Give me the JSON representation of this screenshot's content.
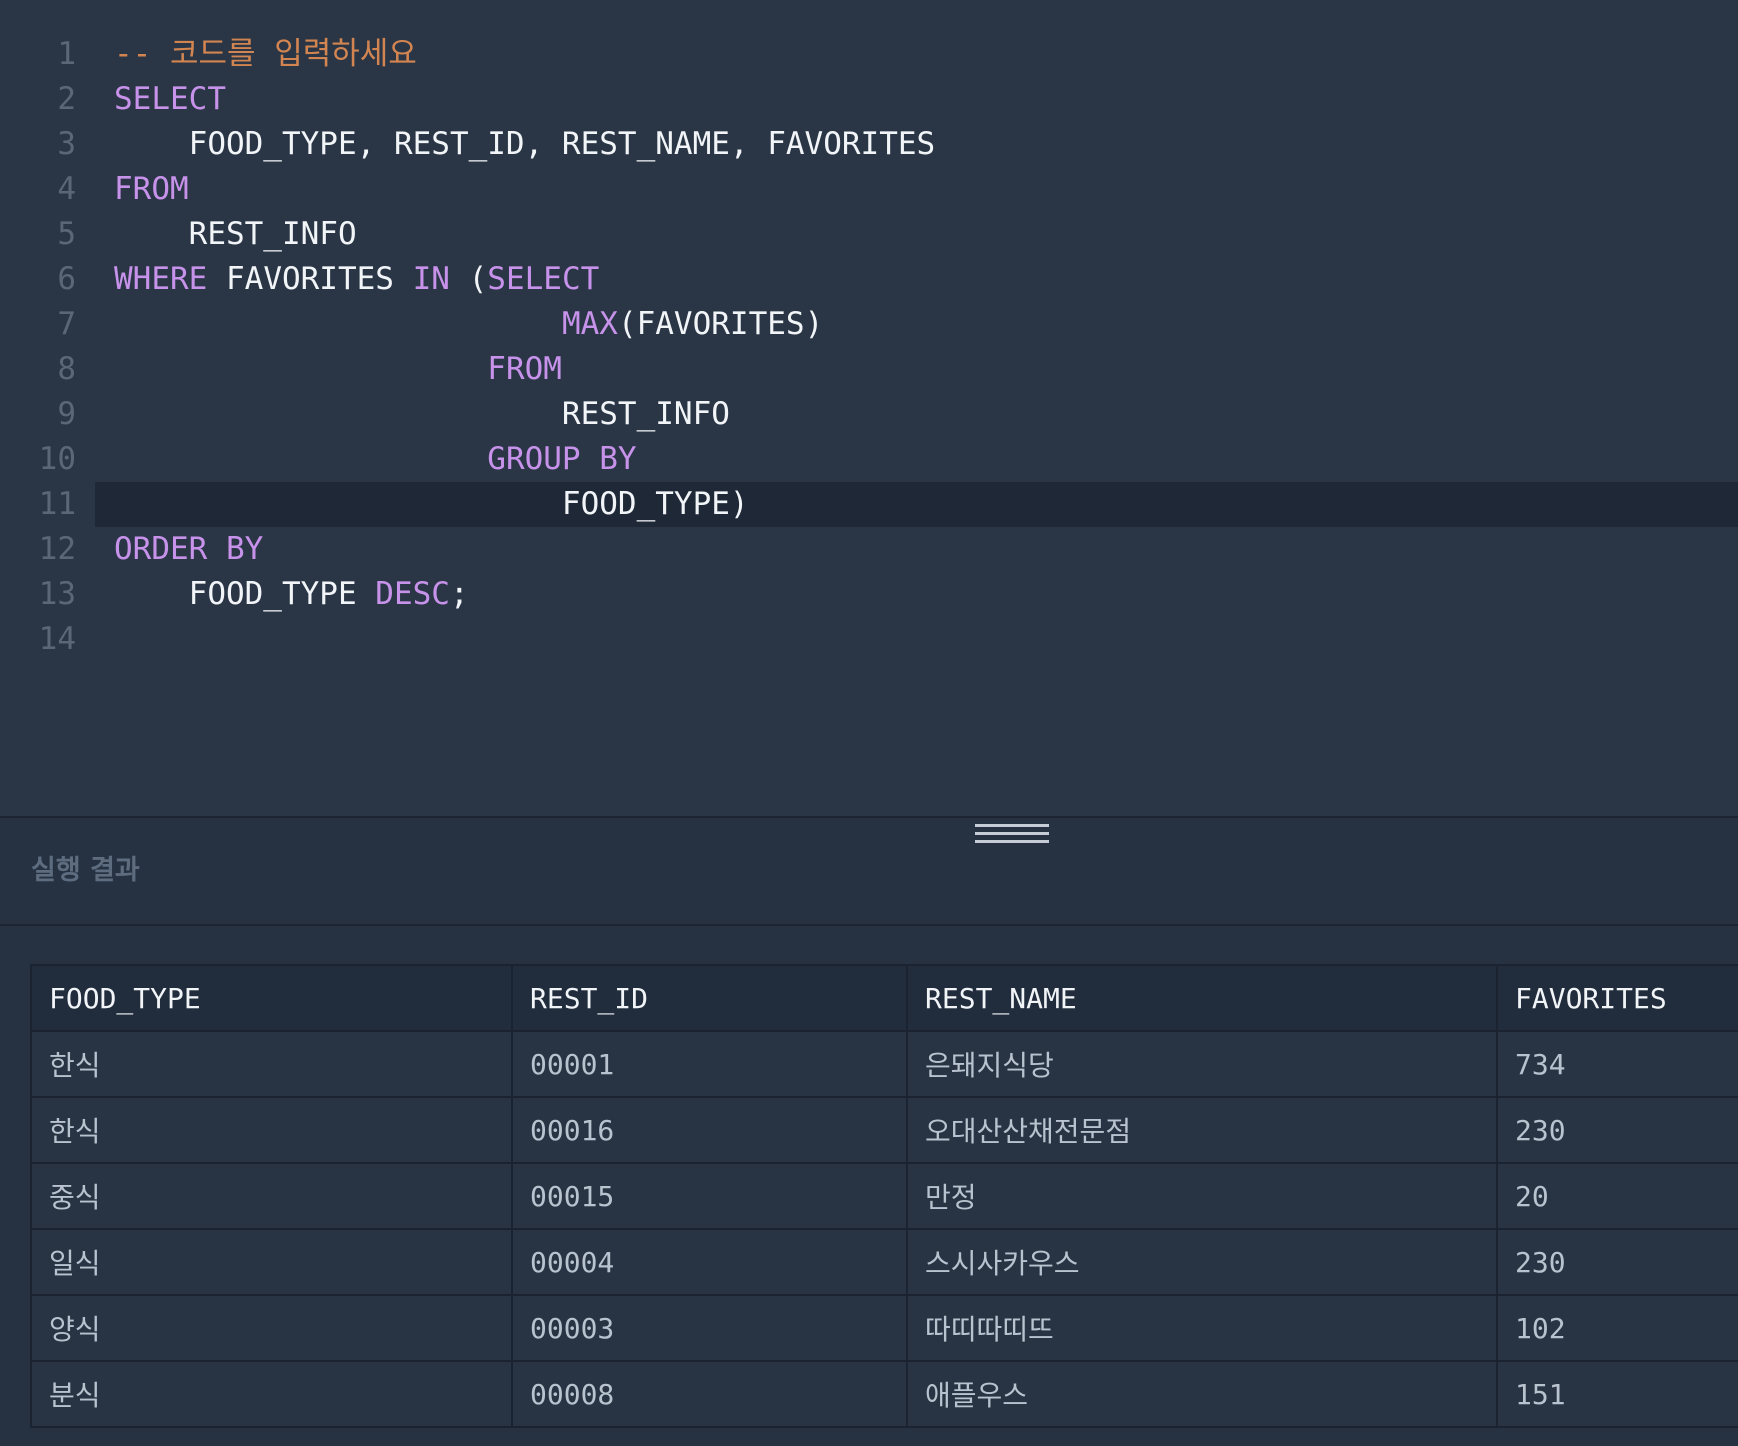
{
  "editor": {
    "lines": [
      {
        "number": "1",
        "tokens": [
          {
            "t": "-- 코드를 입력하세요",
            "k": "comment"
          }
        ]
      },
      {
        "number": "2",
        "tokens": [
          {
            "t": "SELECT",
            "k": "keyword"
          }
        ]
      },
      {
        "number": "3",
        "tokens": [
          {
            "t": "    FOOD_TYPE, REST_ID, REST_NAME, FAVORITES",
            "k": "plain"
          }
        ]
      },
      {
        "number": "4",
        "tokens": [
          {
            "t": "FROM",
            "k": "keyword"
          }
        ]
      },
      {
        "number": "5",
        "tokens": [
          {
            "t": "    REST_INFO",
            "k": "plain"
          }
        ]
      },
      {
        "number": "6",
        "tokens": [
          {
            "t": "WHERE",
            "k": "keyword"
          },
          {
            "t": " FAVORITES ",
            "k": "plain"
          },
          {
            "t": "IN",
            "k": "keyword"
          },
          {
            "t": " (",
            "k": "plain"
          },
          {
            "t": "SELECT",
            "k": "keyword"
          }
        ]
      },
      {
        "number": "7",
        "tokens": [
          {
            "t": "                        ",
            "k": "plain"
          },
          {
            "t": "MAX",
            "k": "keyword"
          },
          {
            "t": "(FAVORITES)",
            "k": "plain"
          }
        ]
      },
      {
        "number": "8",
        "tokens": [
          {
            "t": "                    ",
            "k": "plain"
          },
          {
            "t": "FROM",
            "k": "keyword"
          }
        ]
      },
      {
        "number": "9",
        "tokens": [
          {
            "t": "                        REST_INFO",
            "k": "plain"
          }
        ]
      },
      {
        "number": "10",
        "tokens": [
          {
            "t": "                    ",
            "k": "plain"
          },
          {
            "t": "GROUP BY",
            "k": "keyword"
          }
        ]
      },
      {
        "number": "11",
        "tokens": [
          {
            "t": "                        FOOD_TYPE)",
            "k": "plain"
          }
        ],
        "active": true
      },
      {
        "number": "12",
        "tokens": [
          {
            "t": "ORDER BY",
            "k": "keyword"
          }
        ]
      },
      {
        "number": "13",
        "tokens": [
          {
            "t": "    FOOD_TYPE ",
            "k": "plain"
          },
          {
            "t": "DESC",
            "k": "keyword"
          },
          {
            "t": ";",
            "k": "plain"
          }
        ]
      },
      {
        "number": "14",
        "tokens": []
      }
    ]
  },
  "results": {
    "title": "실행 결과",
    "columns": [
      "FOOD_TYPE",
      "REST_ID",
      "REST_NAME",
      "FAVORITES"
    ],
    "rows": [
      [
        "한식",
        "00001",
        "은돼지식당",
        "734"
      ],
      [
        "한식",
        "00016",
        "오대산산채전문점",
        "230"
      ],
      [
        "중식",
        "00015",
        "만정",
        "20"
      ],
      [
        "일식",
        "00004",
        "스시사카우스",
        "230"
      ],
      [
        "양식",
        "00003",
        "따띠따띠뜨",
        "102"
      ],
      [
        "분식",
        "00008",
        "애플우스",
        "151"
      ]
    ]
  },
  "colors": {
    "background": "#263242",
    "editor_background": "#2a3646",
    "active_line": "#1e2837",
    "keyword": "#c792ea",
    "comment": "#d28550",
    "code_text": "#f2f5f8",
    "line_number": "#5b6676",
    "table_header_bg": "#212c3c",
    "table_cell_text": "#b9c3cf",
    "results_title": "#5d6c7f"
  },
  "icons": {
    "resize_handle": "drag-handle-icon"
  }
}
